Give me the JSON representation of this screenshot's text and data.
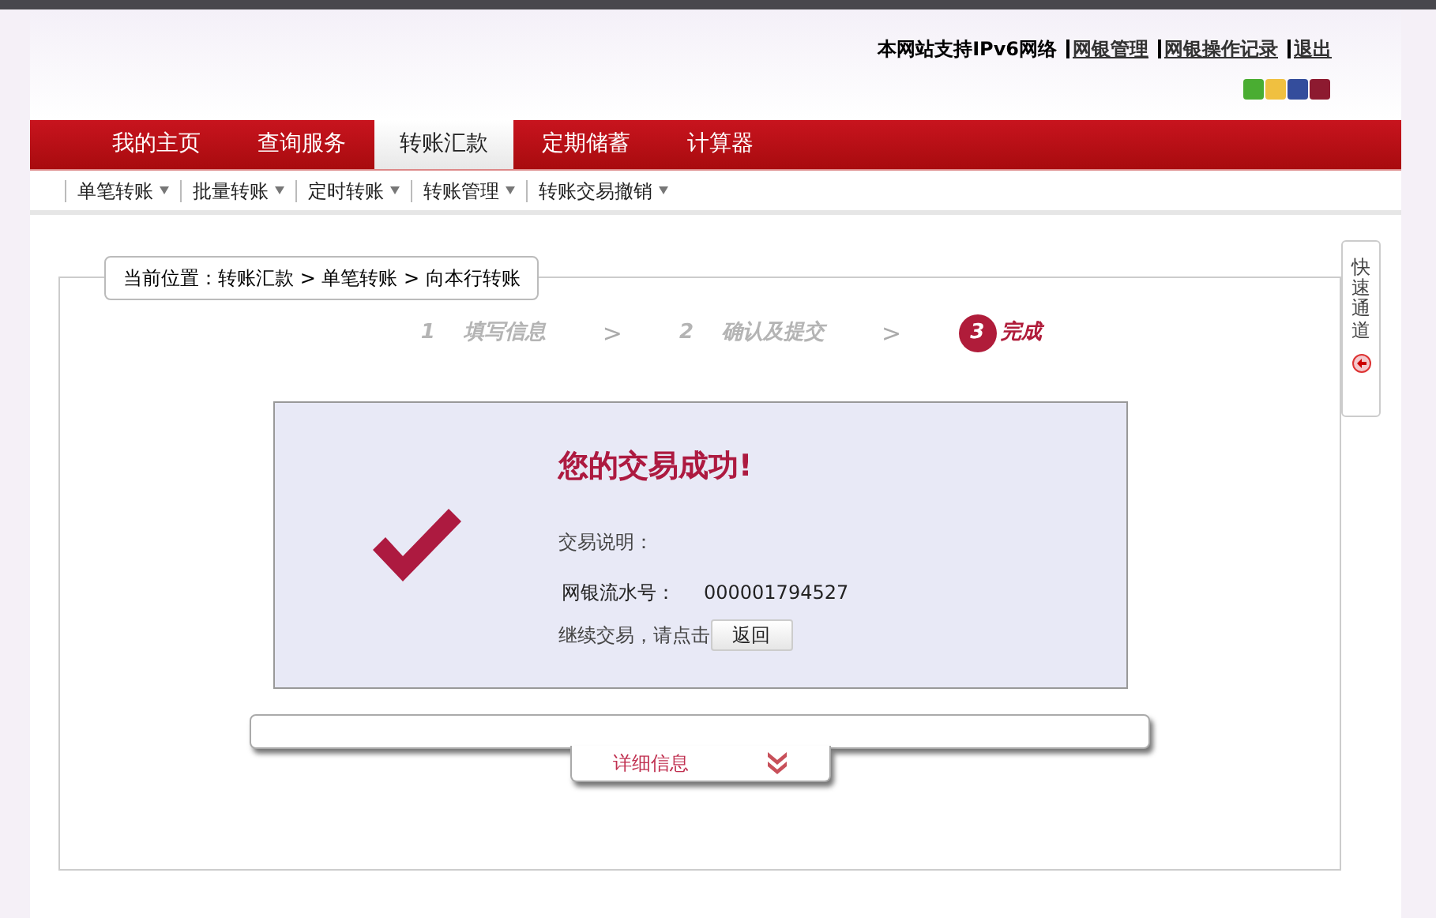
{
  "header": {
    "notice": "本网站支持IPv6网络",
    "links": [
      {
        "label": "网银管理"
      },
      {
        "label": "网银操作记录"
      },
      {
        "label": "退出"
      }
    ],
    "themes": [
      {
        "color": "#4aad32"
      },
      {
        "color": "#f0c040"
      },
      {
        "color": "#344d9c"
      },
      {
        "color": "#8d1a30"
      }
    ]
  },
  "nav": [
    {
      "label": "我的主页",
      "selected": false
    },
    {
      "label": "查询服务",
      "selected": false
    },
    {
      "label": "转账汇款",
      "selected": true
    },
    {
      "label": "定期储蓄",
      "selected": false
    },
    {
      "label": "计算器",
      "selected": false
    }
  ],
  "subnav": [
    {
      "label": "单笔转账"
    },
    {
      "label": "批量转账"
    },
    {
      "label": "定时转账"
    },
    {
      "label": "转账管理"
    },
    {
      "label": "转账交易撤销"
    }
  ],
  "breadcrumb": "当前位置：转账汇款 > 单笔转账 > 向本行转账",
  "steps": [
    {
      "number": "1",
      "label": "填写信息",
      "selected": false
    },
    {
      "number": "2",
      "label": "确认及提交",
      "selected": false
    },
    {
      "number": "3",
      "label": "完成",
      "selected": true
    }
  ],
  "step_separator": ">",
  "result": {
    "title": "您的交易成功!",
    "description_label": "交易说明：",
    "serial_label": "网银流水号：",
    "serial_value": "000001794527",
    "continue_text": "继续交易，请点击",
    "back_button": "返回"
  },
  "details_tab": "详细信息",
  "quick_access": "快速通道"
}
